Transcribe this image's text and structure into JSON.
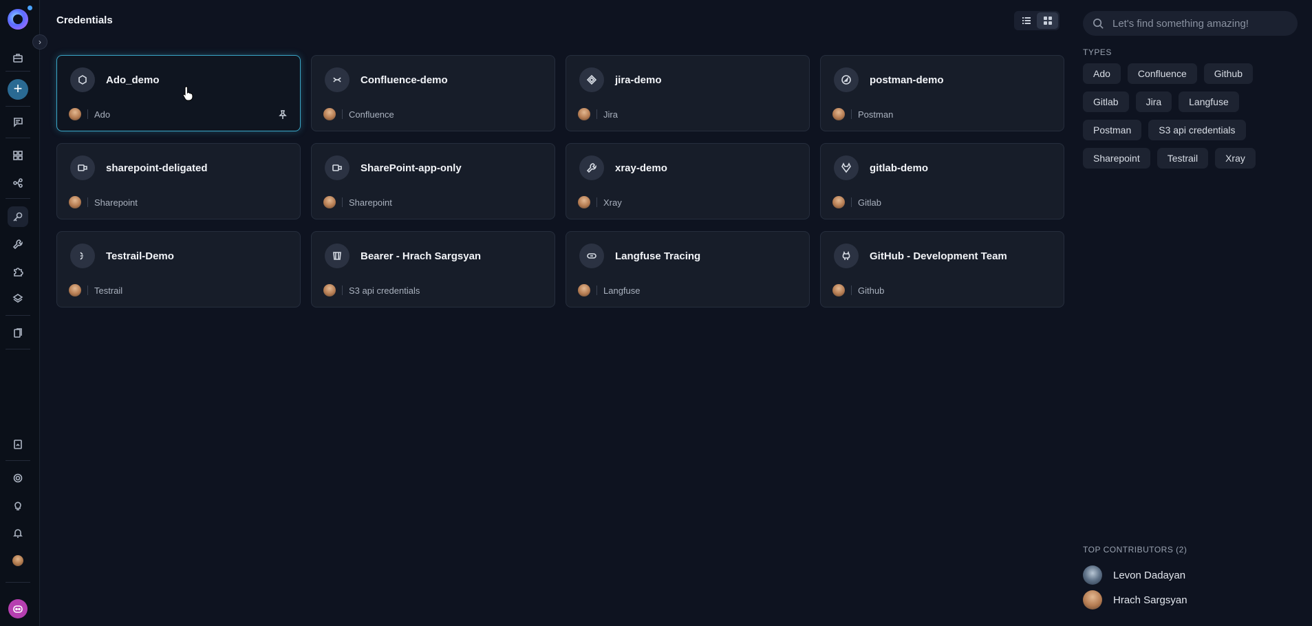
{
  "page": {
    "title": "Credentials"
  },
  "search": {
    "placeholder": "Let's find something amazing!"
  },
  "types": {
    "label": "TYPES",
    "chips": [
      "Ado",
      "Confluence",
      "Github",
      "Gitlab",
      "Jira",
      "Langfuse",
      "Postman",
      "S3 api credentials",
      "Sharepoint",
      "Testrail",
      "Xray"
    ]
  },
  "cards": [
    {
      "title": "Ado_demo",
      "type": "Ado",
      "icon": "azure-devops-icon"
    },
    {
      "title": "Confluence-demo",
      "type": "Confluence",
      "icon": "confluence-icon"
    },
    {
      "title": "jira-demo",
      "type": "Jira",
      "icon": "jira-icon"
    },
    {
      "title": "postman-demo",
      "type": "Postman",
      "icon": "postman-icon"
    },
    {
      "title": "sharepoint-deligated",
      "type": "Sharepoint",
      "icon": "sharepoint-icon"
    },
    {
      "title": "SharePoint-app-only",
      "type": "Sharepoint",
      "icon": "sharepoint-icon"
    },
    {
      "title": "xray-demo",
      "type": "Xray",
      "icon": "wrench-icon"
    },
    {
      "title": "gitlab-demo",
      "type": "Gitlab",
      "icon": "gitlab-icon"
    },
    {
      "title": "Testrail-Demo",
      "type": "Testrail",
      "icon": "testrail-icon"
    },
    {
      "title": "Bearer - Hrach Sargsyan",
      "type": "S3 api credentials",
      "icon": "bucket-icon"
    },
    {
      "title": "Langfuse Tracing",
      "type": "Langfuse",
      "icon": "langfuse-icon"
    },
    {
      "title": "GitHub - Development Team",
      "type": "Github",
      "icon": "github-icon"
    }
  ],
  "contributors": {
    "label": "TOP CONTRIBUTORS (2)",
    "people": [
      {
        "name": "Levon Dadayan"
      },
      {
        "name": "Hrach Sargsyan"
      }
    ]
  },
  "colors": {
    "accent": "#3aa7c9",
    "add_button": "#2a6a93",
    "bot_button": "#b63fb0"
  }
}
